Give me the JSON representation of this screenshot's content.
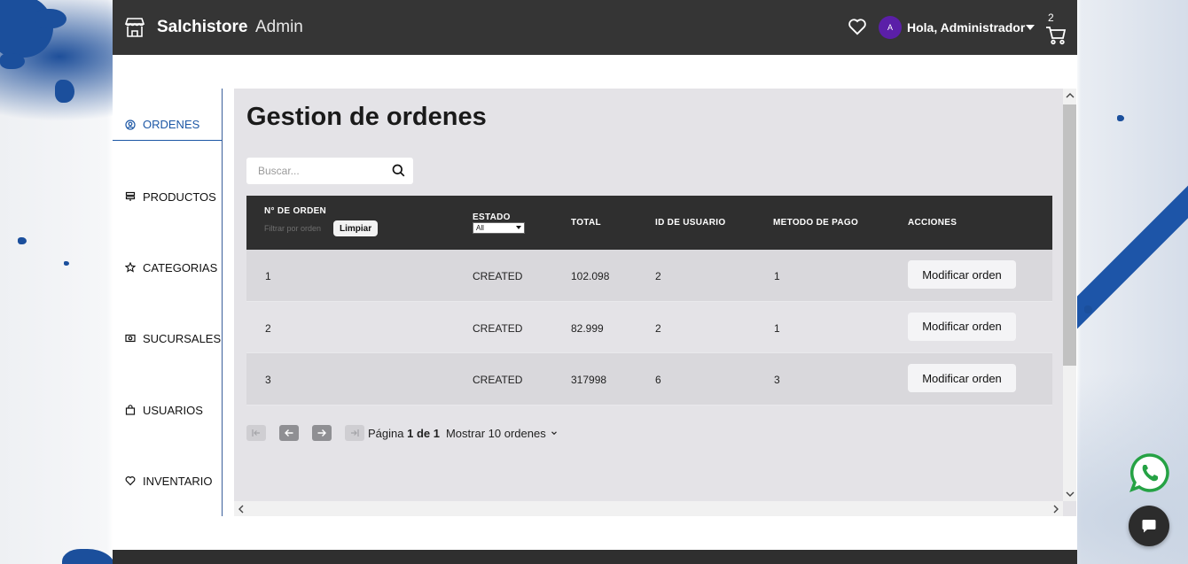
{
  "header": {
    "brand": "Salchistore",
    "brand_sub": "Admin",
    "avatar_initial": "A",
    "greeting": "Hola, Administrador",
    "cart_count": "2"
  },
  "sidebar": {
    "items": [
      {
        "label": "ORDENES",
        "icon": "user-circle-icon",
        "active": true
      },
      {
        "label": "PRODUCTOS",
        "icon": "stack-icon"
      },
      {
        "label": "CATEGORIAS",
        "icon": "star-icon"
      },
      {
        "label": "SUCURSALES",
        "icon": "store-icon"
      },
      {
        "label": "USUARIOS",
        "icon": "bag-icon"
      },
      {
        "label": "INVENTARIO",
        "icon": "heart-icon"
      }
    ]
  },
  "main": {
    "title": "Gestion de ordenes",
    "search_placeholder": "Buscar...",
    "table": {
      "headers": {
        "order_no": "N° DE ORDEN",
        "state": "ESTADO",
        "total": "TOTAL",
        "user_id": "ID DE USUARIO",
        "payment": "METODO DE PAGO",
        "actions": "ACCIONES"
      },
      "filter_placeholder": "Filtrar por orden",
      "clear_label": "Limpiar",
      "state_filter_value": "All",
      "rows": [
        {
          "order": "1",
          "state": "CREATED",
          "total": "102.098",
          "user": "2",
          "payment": "1",
          "action": "Modificar orden"
        },
        {
          "order": "2",
          "state": "CREATED",
          "total": "82.999",
          "user": "2",
          "payment": "1",
          "action": "Modificar orden"
        },
        {
          "order": "3",
          "state": "CREATED",
          "total": "317998",
          "user": "6",
          "payment": "3",
          "action": "Modificar orden"
        }
      ]
    },
    "pagination": {
      "page_prefix": "Página",
      "page_value": "1 de 1",
      "show_label": "Mostrar 10 ordenes"
    }
  },
  "colors": {
    "topbar": "#353535",
    "accent": "#1c57a5",
    "avatar": "#5b1fa8",
    "table_header": "#2f2f2f",
    "whatsapp": "#25a244"
  }
}
